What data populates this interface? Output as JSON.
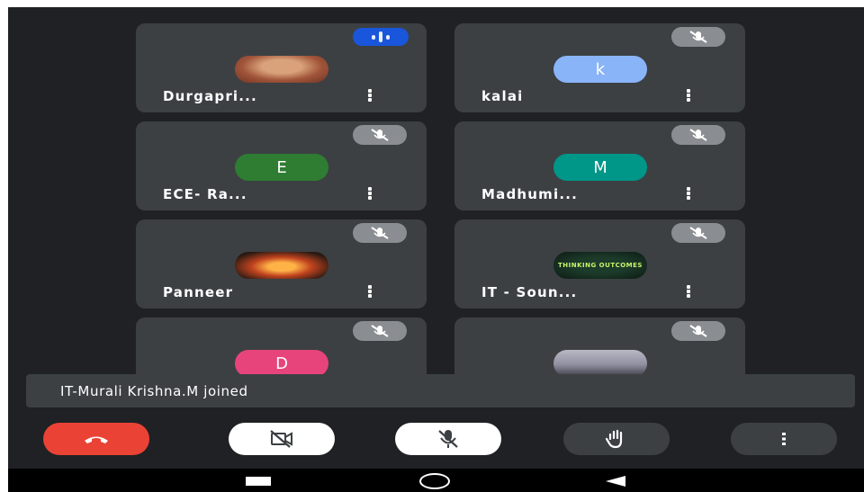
{
  "participants": [
    {
      "name": "Durgapri...",
      "avatar": {
        "kind": "photo",
        "letter": "",
        "color": ""
      },
      "mic": "speaking"
    },
    {
      "name": "kalai",
      "avatar": {
        "kind": "letter",
        "letter": "k",
        "color": "#8ab4f8"
      },
      "mic": "muted"
    },
    {
      "name": "ECE- Ra...",
      "avatar": {
        "kind": "letter",
        "letter": "E",
        "color": "#2e7d32"
      },
      "mic": "muted"
    },
    {
      "name": "Madhumi...",
      "avatar": {
        "kind": "letter",
        "letter": "M",
        "color": "#009688"
      },
      "mic": "muted"
    },
    {
      "name": "Panneer",
      "avatar": {
        "kind": "photo",
        "letter": "",
        "color": ""
      },
      "mic": "muted"
    },
    {
      "name": "IT - Soun...",
      "avatar": {
        "kind": "photo",
        "letter": "",
        "color": "",
        "text": "THINKING OUTCOMES"
      },
      "mic": "muted"
    },
    {
      "name": "",
      "avatar": {
        "kind": "letter",
        "letter": "D",
        "color": "#e8447c"
      },
      "mic": "muted"
    },
    {
      "name": "",
      "avatar": {
        "kind": "photo",
        "letter": "",
        "color": ""
      },
      "mic": "muted"
    }
  ],
  "toast": {
    "text": "IT-Murali Krishna.M joined"
  },
  "controls": [
    {
      "id": "end-call",
      "icon": "phone-hangup-icon",
      "bg": "#ea4335"
    },
    {
      "id": "camera-off",
      "icon": "camera-off-icon",
      "bg": "#ffffff"
    },
    {
      "id": "mic-off",
      "icon": "mic-off-icon",
      "bg": "#ffffff"
    },
    {
      "id": "raise-hand",
      "icon": "hand-icon",
      "bg": "#3c4043"
    },
    {
      "id": "more-options",
      "icon": "more-vert-icon",
      "bg": "#3c4043"
    }
  ],
  "nav": [
    "recents-icon",
    "home-icon",
    "back-icon"
  ],
  "colors": {
    "screen_bg": "#202124",
    "tile_bg": "#3c4043",
    "muted_badge": "#8a8d91",
    "speaking_badge": "#1a56db"
  }
}
